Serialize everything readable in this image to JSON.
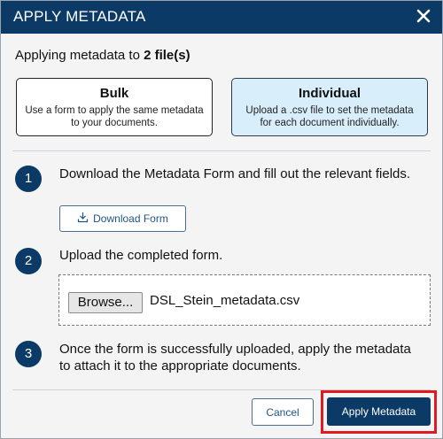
{
  "dialog": {
    "title": "APPLY METADATA",
    "close_icon": "close-icon",
    "intro_prefix": "Applying metadata to ",
    "intro_count": "2 file(s)"
  },
  "modes": [
    {
      "title": "Bulk",
      "description": "Use a form to apply the same metadata to your documents.",
      "selected": false
    },
    {
      "title": "Individual",
      "description": "Upload a .csv file to set the metadata for each document individually.",
      "selected": true
    }
  ],
  "steps": [
    {
      "number": "1",
      "text": "Download the Metadata Form and fill out the relevant fields."
    },
    {
      "number": "2",
      "text": "Upload the completed form."
    },
    {
      "number": "3",
      "text": "Once the form is successfully uploaded, apply the metadata to attach it to the appropriate documents."
    }
  ],
  "download_button": {
    "label": "Download Form",
    "icon": "download-icon"
  },
  "upload": {
    "browse_label": "Browse...",
    "file_name": "DSL_Stein_metadata.csv"
  },
  "footer": {
    "cancel_label": "Cancel",
    "apply_label": "Apply Metadata"
  },
  "colors": {
    "primary": "#0b3a66",
    "selected_card": "#d9eefb",
    "highlight": "#e11a22"
  }
}
